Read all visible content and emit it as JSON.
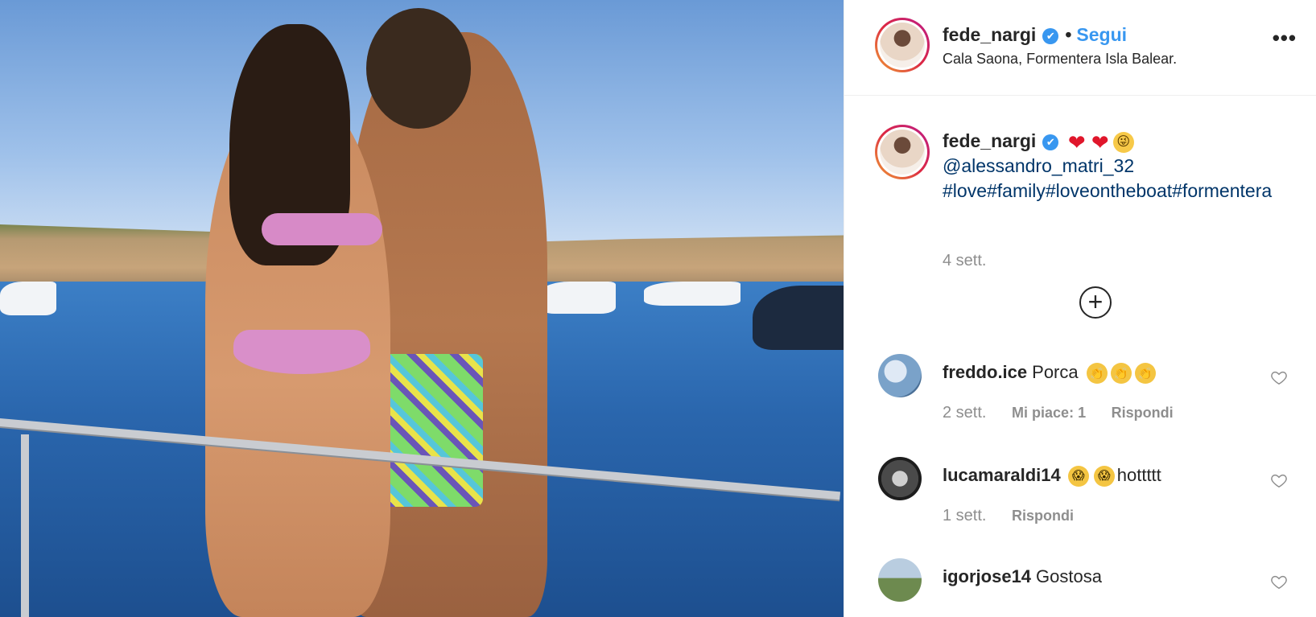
{
  "header": {
    "username": "fede_nargi",
    "verified_mark": "✔",
    "separator": "•",
    "follow_label": "Segui",
    "location": "Cala Saona, Formentera Isla Balear.",
    "more_label": "•••"
  },
  "caption": {
    "username": "fede_nargi",
    "mention": "@alessandro_matri_32",
    "hashtags": "#love#family#loveontheboat#formentera",
    "emojis": [
      "heart-emoji",
      "hearts-emoji",
      "winking-tongue-emoji"
    ],
    "time": "4 sett.",
    "load_more_label": "+"
  },
  "comments": [
    {
      "username": "freddo.ice",
      "text": "Porca",
      "emojis": [
        "clapping-hands-emoji",
        "clapping-hands-emoji",
        "clapping-hands-emoji"
      ],
      "time": "2 sett.",
      "likes": "Mi piace: 1",
      "reply": "Rispondi"
    },
    {
      "username": "lucamaraldi14",
      "text": "hottttt",
      "emojis": [
        "screaming-face-emoji",
        "screaming-face-emoji"
      ],
      "time": "1 sett.",
      "reply": "Rispondi"
    },
    {
      "username": "igorjose14",
      "text": "Gostosa"
    }
  ],
  "colors": {
    "link_blue": "#3897f0",
    "mention_blue": "#003569",
    "muted_gray": "#8e8e8e",
    "text_dark": "#262626"
  }
}
